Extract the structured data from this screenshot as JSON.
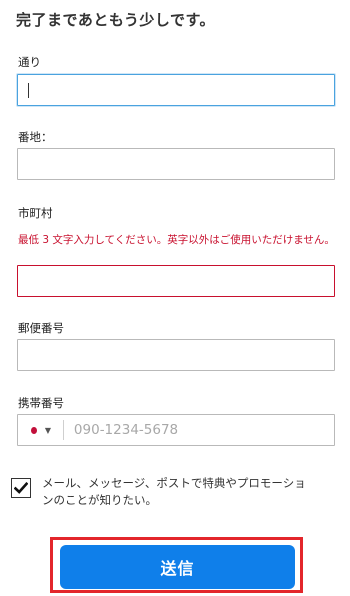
{
  "header": {
    "title": "完了まであともう少しです。"
  },
  "form": {
    "street": {
      "label": "通り",
      "value": ""
    },
    "house_number": {
      "label": "番地：",
      "value": ""
    },
    "city": {
      "label": "市町村",
      "value": "",
      "error": "最低 3 文字入力してください。英字以外はご使用いただけません。"
    },
    "postal_code": {
      "label": "郵便番号",
      "value": ""
    },
    "phone": {
      "label": "携帯番号",
      "placeholder": "090-1234-5678",
      "value": ""
    }
  },
  "consent": {
    "checked": true,
    "label": "メール、メッセージ、ポストで特典やプロモーションのことが知りたい。"
  },
  "submit": {
    "label": "送信"
  },
  "colors": {
    "accent": "#0f7fea",
    "error": "#c8102e",
    "focus": "#4aa3df"
  },
  "icons": {
    "flag": "japan-flag-icon",
    "dropdown": "chevron-down-icon",
    "check": "check-icon"
  }
}
